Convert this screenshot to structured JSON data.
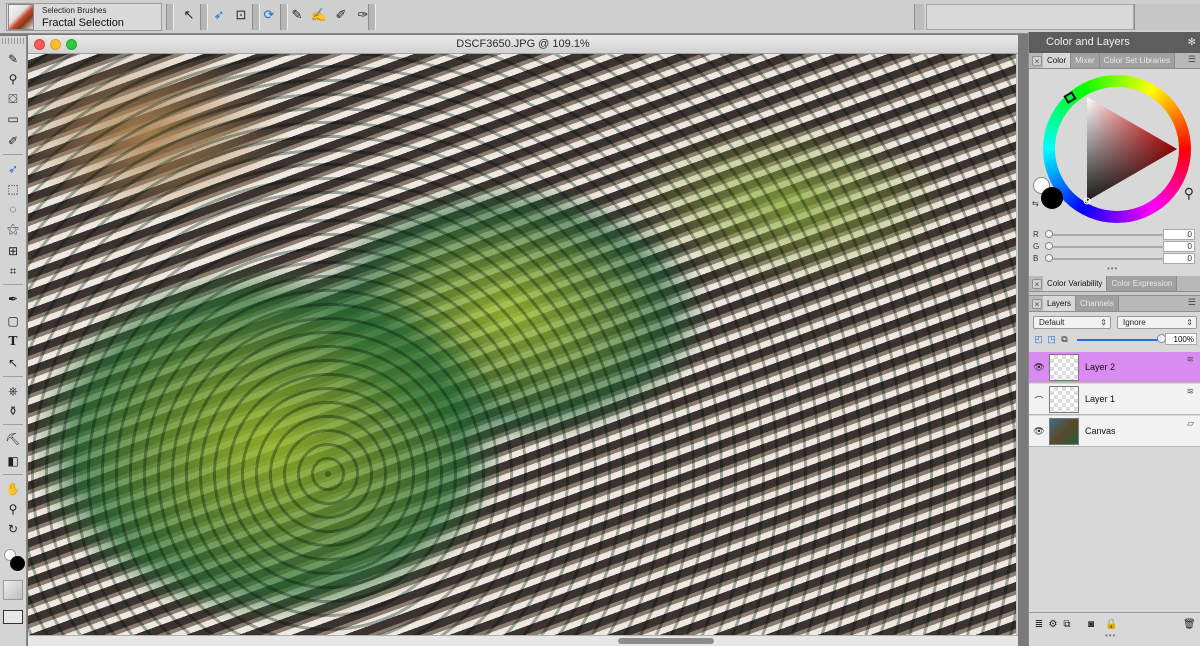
{
  "property_bar": {
    "brush_category": "Selection Brushes",
    "brush_variant": "Fractal Selection"
  },
  "document": {
    "title": "DSCF3650.JPG @ 109.1%"
  },
  "right_panel": {
    "title": "Color and Layers",
    "color_tabs": [
      "Color",
      "Mixer",
      "Color Set Libraries"
    ],
    "rgb": [
      {
        "label": "R",
        "value": "0"
      },
      {
        "label": "G",
        "value": "0"
      },
      {
        "label": "B",
        "value": "0"
      }
    ],
    "variability_tabs": [
      "Color Variability",
      "Color Expression"
    ],
    "layer_tabs": [
      "Layers",
      "Channels"
    ],
    "composite_method": "Default",
    "composite_depth": "Ignore",
    "opacity": "100%",
    "layers": [
      {
        "name": "Layer 2",
        "selected": true
      },
      {
        "name": "Layer 1",
        "selected": false
      },
      {
        "name": "Canvas",
        "selected": false
      }
    ]
  },
  "colors": {
    "selected_layer": "#d88cf0",
    "accent": "#1e6fd6",
    "panel_title_bg": "#5d5d5d"
  }
}
